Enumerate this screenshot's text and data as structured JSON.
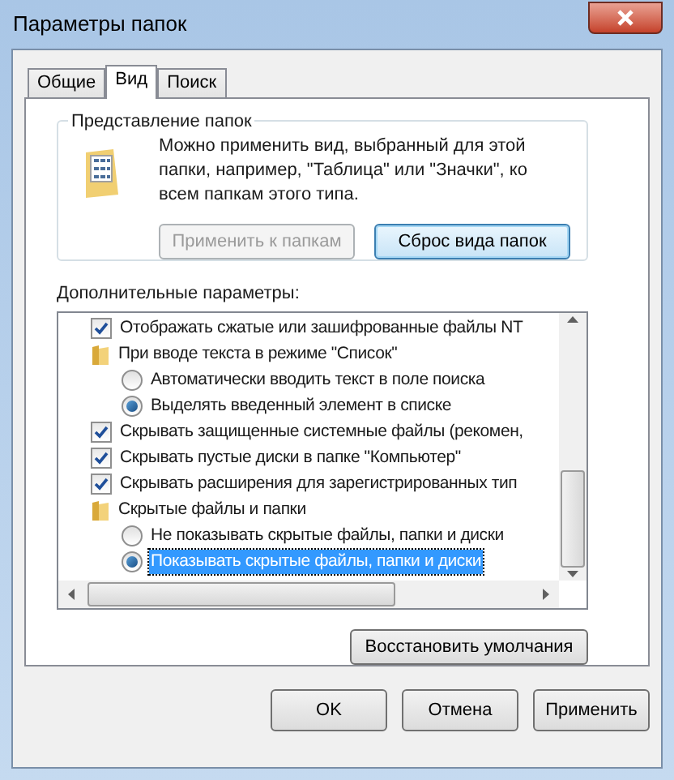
{
  "window": {
    "title": "Параметры папок"
  },
  "tabs": [
    {
      "label": "Общие",
      "selected": false
    },
    {
      "label": "Вид",
      "selected": true
    },
    {
      "label": "Поиск",
      "selected": false
    }
  ],
  "folder_views": {
    "title": "Представление папок",
    "description": "Можно применить вид, выбранный для этой папки, например, \"Таблица\" или \"Значки\", ко всем папкам этого типа.",
    "buttons": [
      {
        "label": "Применить к папкам",
        "disabled": true,
        "focused": false
      },
      {
        "label": "Сброс вида папок",
        "disabled": false,
        "focused": true
      }
    ]
  },
  "advanced": {
    "title": "Дополнительные параметры:",
    "items": [
      {
        "kind": "checkbox",
        "label": "Отображать сжатые или зашифрованные файлы NT",
        "checked": true,
        "selected": false
      },
      {
        "kind": "folder",
        "label": "При вводе текста в режиме \"Список\"",
        "selected": false,
        "children": [
          {
            "kind": "radio",
            "label": "Автоматически вводить текст в поле поиска",
            "checked": false,
            "selected": false
          },
          {
            "kind": "radio",
            "label": "Выделять введенный элемент в списке",
            "checked": true,
            "selected": false
          }
        ]
      },
      {
        "kind": "checkbox",
        "label": "Скрывать защищенные системные файлы (рекомен,",
        "checked": true,
        "selected": false
      },
      {
        "kind": "checkbox",
        "label": "Скрывать пустые диски в папке \"Компьютер\"",
        "checked": true,
        "selected": false
      },
      {
        "kind": "checkbox",
        "label": "Скрывать расширения для зарегистрированных тип",
        "checked": true,
        "selected": false
      },
      {
        "kind": "folder",
        "label": "Скрытые файлы и папки",
        "selected": false,
        "children": [
          {
            "kind": "radio",
            "label": "Не показывать скрытые файлы, папки и диски",
            "checked": false,
            "selected": false
          },
          {
            "kind": "radio",
            "label": "Показывать скрытые файлы, папки и диски",
            "checked": true,
            "selected": true
          }
        ]
      }
    ],
    "restore_button": "Восстановить умолчания"
  },
  "buttons": [
    {
      "label": "OK"
    },
    {
      "label": "Отмена"
    },
    {
      "label": "Применить"
    }
  ]
}
